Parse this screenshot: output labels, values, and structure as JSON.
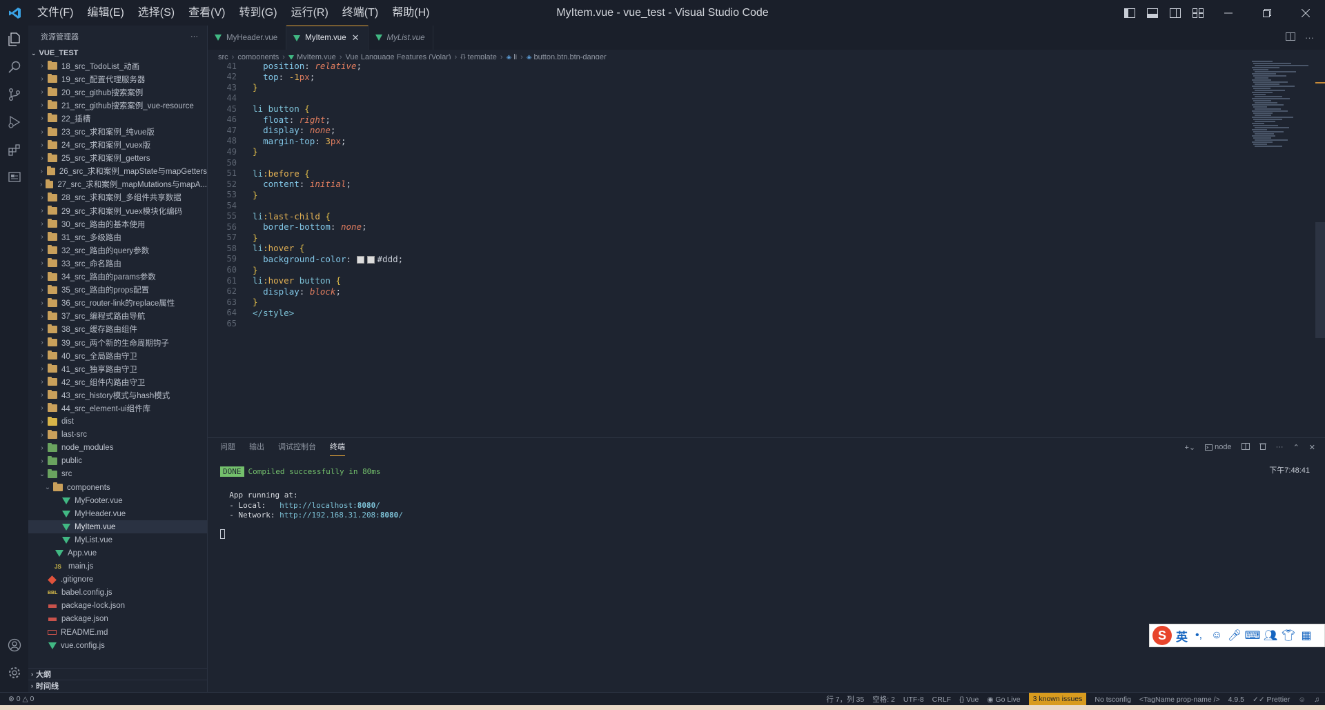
{
  "window": {
    "title": "MyItem.vue - vue_test - Visual Studio Code",
    "menu": [
      "文件(F)",
      "编辑(E)",
      "选择(S)",
      "查看(V)",
      "转到(G)",
      "运行(R)",
      "终端(T)",
      "帮助(H)"
    ]
  },
  "sidebar": {
    "title": "资源管理器",
    "more": "···",
    "root": "VUE_TEST",
    "items": [
      {
        "label": "18_src_TodoList_动画",
        "type": "folder"
      },
      {
        "label": "19_src_配置代理服务器",
        "type": "folder"
      },
      {
        "label": "20_src_github搜索案例",
        "type": "folder"
      },
      {
        "label": "21_src_github搜索案例_vue-resource",
        "type": "folder"
      },
      {
        "label": "22_插槽",
        "type": "folder"
      },
      {
        "label": "23_src_求和案例_纯vue版",
        "type": "folder"
      },
      {
        "label": "24_src_求和案例_vuex版",
        "type": "folder"
      },
      {
        "label": "25_src_求和案例_getters",
        "type": "folder"
      },
      {
        "label": "26_src_求和案例_mapState与mapGetters",
        "type": "folder"
      },
      {
        "label": "27_src_求和案例_mapMutations与mapA...",
        "type": "folder"
      },
      {
        "label": "28_src_求和案例_多组件共享数据",
        "type": "folder"
      },
      {
        "label": "29_src_求和案例_vuex模块化编码",
        "type": "folder"
      },
      {
        "label": "30_src_路由的基本使用",
        "type": "folder"
      },
      {
        "label": "31_src_多级路由",
        "type": "folder"
      },
      {
        "label": "32_src_路由的query参数",
        "type": "folder"
      },
      {
        "label": "33_src_命名路由",
        "type": "folder"
      },
      {
        "label": "34_src_路由的params参数",
        "type": "folder"
      },
      {
        "label": "35_src_路由的props配置",
        "type": "folder"
      },
      {
        "label": "36_src_router-link的replace属性",
        "type": "folder"
      },
      {
        "label": "37_src_编程式路由导航",
        "type": "folder"
      },
      {
        "label": "38_src_缓存路由组件",
        "type": "folder"
      },
      {
        "label": "39_src_两个新的生命周期钩子",
        "type": "folder"
      },
      {
        "label": "40_src_全局路由守卫",
        "type": "folder"
      },
      {
        "label": "41_src_独享路由守卫",
        "type": "folder"
      },
      {
        "label": "42_src_组件内路由守卫",
        "type": "folder"
      },
      {
        "label": "43_src_history模式与hash模式",
        "type": "folder"
      },
      {
        "label": "44_src_element-ui组件库",
        "type": "folder"
      },
      {
        "label": "dist",
        "type": "folder-yellow"
      },
      {
        "label": "last-src",
        "type": "folder"
      },
      {
        "label": "node_modules",
        "type": "folder-green"
      },
      {
        "label": "public",
        "type": "folder-green"
      },
      {
        "label": "src",
        "type": "folder-green-open"
      },
      {
        "label": "components",
        "type": "folder-open-nested"
      },
      {
        "label": "MyFooter.vue",
        "type": "vue-deep"
      },
      {
        "label": "MyHeader.vue",
        "type": "vue-deep"
      },
      {
        "label": "MyItem.vue",
        "type": "vue-deep-selected"
      },
      {
        "label": "MyList.vue",
        "type": "vue-deep"
      },
      {
        "label": "App.vue",
        "type": "vue-mid"
      },
      {
        "label": "main.js",
        "type": "js-mid"
      },
      {
        "label": ".gitignore",
        "type": "git"
      },
      {
        "label": "babel.config.js",
        "type": "babel"
      },
      {
        "label": "package-lock.json",
        "type": "json"
      },
      {
        "label": "package.json",
        "type": "json"
      },
      {
        "label": "README.md",
        "type": "md"
      },
      {
        "label": "vue.config.js",
        "type": "vuecfg"
      }
    ],
    "outline": "大纲",
    "timeline": "时间线"
  },
  "tabs": [
    {
      "label": "MyHeader.vue",
      "active": false,
      "italic": false
    },
    {
      "label": "MyItem.vue",
      "active": true,
      "italic": false
    },
    {
      "label": "MyList.vue",
      "active": false,
      "italic": true
    }
  ],
  "breadcrumb": [
    "src",
    "components",
    "MyItem.vue",
    "Vue Language Features (Volar)",
    "{} template",
    "li",
    "button.btn.btn-danger"
  ],
  "editor": {
    "lines": [
      {
        "n": "41",
        "tokens": [
          [
            "  ",
            "p"
          ],
          [
            "position",
            "prop"
          ],
          [
            ": ",
            "p"
          ],
          [
            "relative",
            "val"
          ],
          [
            ";",
            "p"
          ]
        ]
      },
      {
        "n": "42",
        "tokens": [
          [
            "  ",
            "p"
          ],
          [
            "top",
            "prop"
          ],
          [
            ": ",
            "p"
          ],
          [
            "-1",
            "num"
          ],
          [
            "px",
            "unit"
          ],
          [
            ";",
            "p"
          ]
        ]
      },
      {
        "n": "43",
        "tokens": [
          [
            "}",
            "brace"
          ]
        ]
      },
      {
        "n": "44",
        "tokens": []
      },
      {
        "n": "45",
        "tokens": [
          [
            "li button",
            "tag"
          ],
          [
            " ",
            "p"
          ],
          [
            "{",
            "brace"
          ]
        ]
      },
      {
        "n": "46",
        "tokens": [
          [
            "  ",
            "p"
          ],
          [
            "float",
            "prop"
          ],
          [
            ": ",
            "p"
          ],
          [
            "right",
            "val"
          ],
          [
            ";",
            "p"
          ]
        ]
      },
      {
        "n": "47",
        "tokens": [
          [
            "  ",
            "p"
          ],
          [
            "display",
            "prop"
          ],
          [
            ": ",
            "p"
          ],
          [
            "none",
            "val"
          ],
          [
            ";",
            "p"
          ]
        ]
      },
      {
        "n": "48",
        "tokens": [
          [
            "  ",
            "p"
          ],
          [
            "margin-top",
            "prop"
          ],
          [
            ": ",
            "p"
          ],
          [
            "3",
            "num"
          ],
          [
            "px",
            "unit"
          ],
          [
            ";",
            "p"
          ]
        ]
      },
      {
        "n": "49",
        "tokens": [
          [
            "}",
            "brace"
          ]
        ]
      },
      {
        "n": "50",
        "tokens": []
      },
      {
        "n": "51",
        "tokens": [
          [
            "li",
            "tag"
          ],
          [
            ":before",
            "pseudo"
          ],
          [
            " ",
            "p"
          ],
          [
            "{",
            "brace"
          ]
        ]
      },
      {
        "n": "52",
        "tokens": [
          [
            "  ",
            "p"
          ],
          [
            "content",
            "prop"
          ],
          [
            ": ",
            "p"
          ],
          [
            "initial",
            "val"
          ],
          [
            ";",
            "p"
          ]
        ]
      },
      {
        "n": "53",
        "tokens": [
          [
            "}",
            "brace"
          ]
        ]
      },
      {
        "n": "54",
        "tokens": []
      },
      {
        "n": "55",
        "tokens": [
          [
            "li",
            "tag"
          ],
          [
            ":last-child",
            "pseudo"
          ],
          [
            " ",
            "p"
          ],
          [
            "{",
            "brace"
          ]
        ]
      },
      {
        "n": "56",
        "tokens": [
          [
            "  ",
            "p"
          ],
          [
            "border-bottom",
            "prop"
          ],
          [
            ": ",
            "p"
          ],
          [
            "none",
            "val"
          ],
          [
            ";",
            "p"
          ]
        ]
      },
      {
        "n": "57",
        "tokens": [
          [
            "}",
            "brace"
          ]
        ]
      },
      {
        "n": "58",
        "tokens": [
          [
            "li",
            "tag"
          ],
          [
            ":hover",
            "pseudo"
          ],
          [
            " ",
            "p"
          ],
          [
            "{",
            "brace"
          ]
        ]
      },
      {
        "n": "59",
        "tokens": [
          [
            "  ",
            "p"
          ],
          [
            "background-color",
            "prop"
          ],
          [
            ": ",
            "p"
          ],
          [
            "SWATCH",
            "swatch"
          ],
          [
            "#ddd",
            "p"
          ],
          [
            ";",
            "p"
          ]
        ]
      },
      {
        "n": "60",
        "tokens": [
          [
            "}",
            "brace"
          ]
        ]
      },
      {
        "n": "61",
        "tokens": [
          [
            "li",
            "tag"
          ],
          [
            ":hover",
            "pseudo"
          ],
          [
            " button",
            "tag"
          ],
          [
            " ",
            "p"
          ],
          [
            "{",
            "brace"
          ]
        ]
      },
      {
        "n": "62",
        "tokens": [
          [
            "  ",
            "p"
          ],
          [
            "display",
            "prop"
          ],
          [
            ": ",
            "p"
          ],
          [
            "block",
            "val"
          ],
          [
            ";",
            "p"
          ]
        ]
      },
      {
        "n": "63",
        "tokens": [
          [
            "}",
            "brace"
          ]
        ]
      },
      {
        "n": "64",
        "tokens": [
          [
            "</",
            "tag"
          ],
          [
            "style",
            "tag"
          ],
          [
            ">",
            "tag"
          ]
        ]
      },
      {
        "n": "65",
        "tokens": []
      }
    ]
  },
  "panel": {
    "tabs": [
      "问题",
      "输出",
      "调试控制台",
      "终端"
    ],
    "active_tab": "终端",
    "shell": "node",
    "done": "DONE",
    "compiled": "Compiled successfully in 80ms",
    "time": "下午7:48:41",
    "app_running": "App running at:",
    "local_label": "- Local:   ",
    "local_url_prefix": "http://localhost:",
    "local_port": "8080",
    "local_url_suffix": "/",
    "network_label": "- Network: ",
    "network_url_prefix": "http://192.168.31.208:",
    "network_port": "8080",
    "network_url_suffix": "/"
  },
  "statusbar": {
    "errors": "0",
    "warnings": "0",
    "position": "行 7，列 35",
    "spaces": "空格: 2",
    "encoding": "UTF-8",
    "eol": "CRLF",
    "language": "Vue",
    "golive": "Go Live",
    "issues": "3 known issues",
    "tsconfig": "No tsconfig",
    "tagname": "<TagName prop-name />",
    "version": "4.9.5",
    "prettier": "Prettier"
  },
  "ime": {
    "logo": "S",
    "mode": "英"
  },
  "colors": {
    "accent": "#e8a73a",
    "vue_green": "#41b883",
    "done_green": "#74c06c",
    "warn": "#d89b1e"
  }
}
